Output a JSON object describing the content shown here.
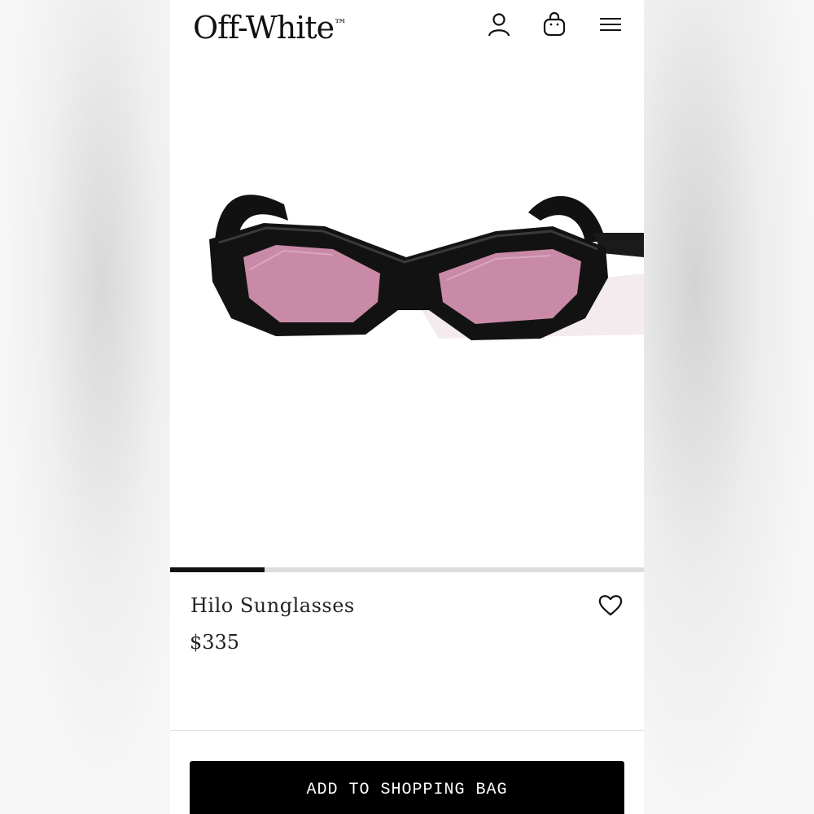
{
  "brand": {
    "logo_text": "Off-White",
    "trademark": "™"
  },
  "header": {
    "icons": [
      "user-icon",
      "shopping-bag-icon",
      "hamburger-menu-icon"
    ]
  },
  "product": {
    "name": "Hilo Sunglasses",
    "price": "$335",
    "image_icon": "sunglasses-photo",
    "lens_color": "#c98aa7",
    "frame_color": "#111111"
  },
  "gallery": {
    "current_index": 1,
    "total_images": 5,
    "progress_fraction": 0.2
  },
  "actions": {
    "wishlist_icon": "heart-icon",
    "add_to_bag_label": "ADD TO SHOPPING BAG"
  },
  "colors": {
    "accent": "#000000",
    "background": "#ffffff",
    "track": "#dddddd"
  }
}
